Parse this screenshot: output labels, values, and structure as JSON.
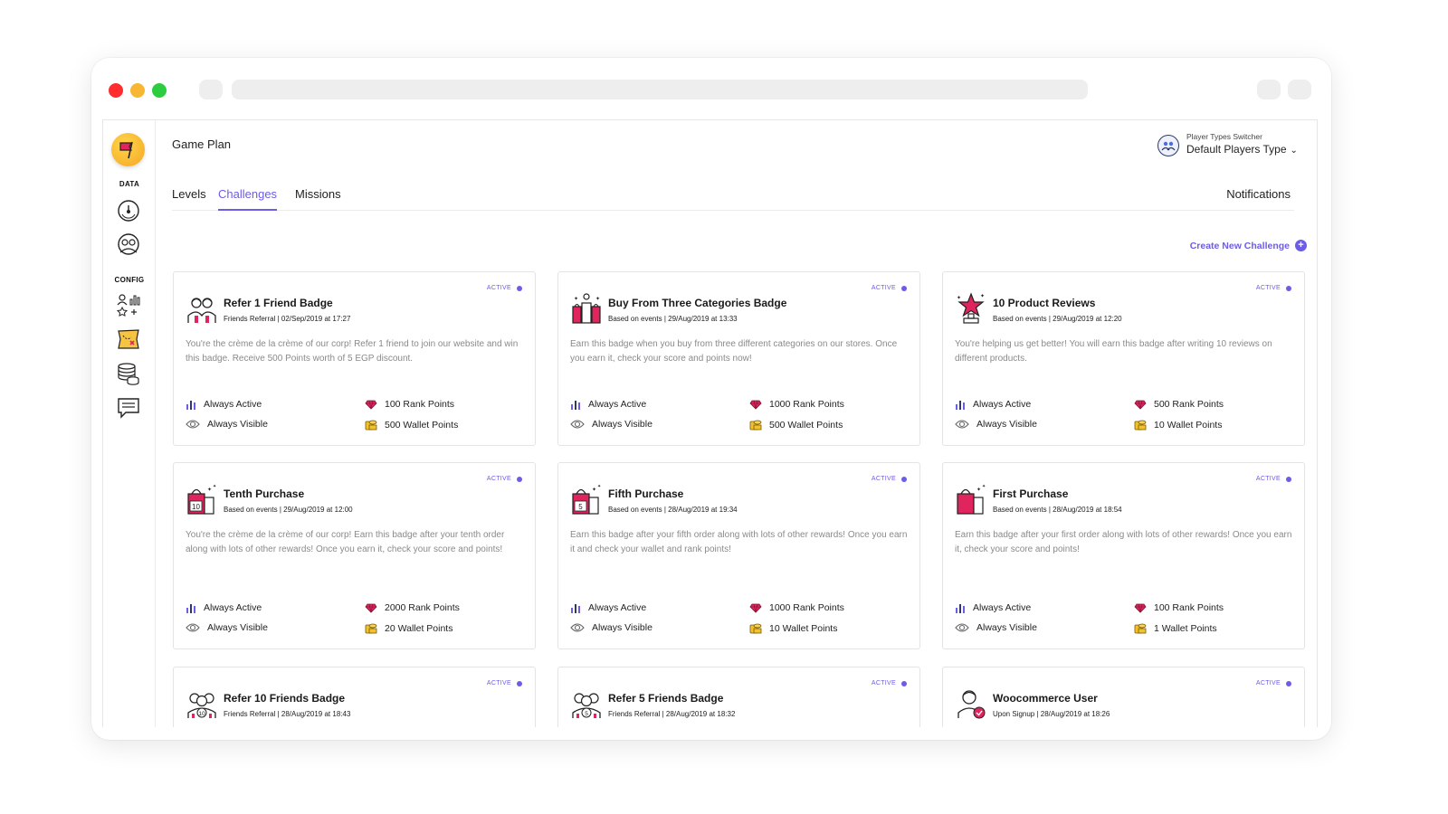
{
  "sidebar": {
    "section_data": "DATA",
    "section_config": "CONFIG",
    "items": [
      {
        "icon": "gauge-icon"
      },
      {
        "icon": "users-icon"
      },
      {
        "icon": "player-stats-icon"
      },
      {
        "icon": "treasure-map-icon"
      },
      {
        "icon": "coins-stack-icon"
      },
      {
        "icon": "chat-icon"
      }
    ]
  },
  "header": {
    "title": "Game Plan",
    "switcher_caption": "Player Types Switcher",
    "switcher_value": "Default Players Type"
  },
  "tabs": {
    "levels": "Levels",
    "challenges": "Challenges",
    "missions": "Missions",
    "notifications": "Notifications"
  },
  "create_button": "Create New Challenge",
  "labels": {
    "status": "ACTIVE",
    "always_active": "Always Active",
    "always_visible": "Always Visible"
  },
  "colors": {
    "accent": "#6c5ce7",
    "badge": "#e0245e"
  },
  "cards": [
    {
      "title": "Refer 1 Friend Badge",
      "meta": "Friends Referral | 02/Sep/2019 at 17:27",
      "description": "You're the crème de la crème of our corp! Refer 1 friend to join our website and win this badge. Receive 500 Points worth of 5 EGP discount.",
      "rank_points": "100 Rank Points",
      "wallet_points": "500 Wallet Points",
      "icon": "referral-badge-icon"
    },
    {
      "title": "Buy From Three Categories Badge",
      "meta": "Based on events | 29/Aug/2019 at 13:33",
      "description": "Earn this badge when you buy from three different categories on our stores. Once you earn it, check your score and points now!",
      "rank_points": "1000 Rank Points",
      "wallet_points": "500 Wallet Points",
      "icon": "shopping-bags-icon"
    },
    {
      "title": "10 Product Reviews",
      "meta": "Based on events | 29/Aug/2019 at 12:20",
      "description": "You're helping us get better! You will earn this badge after writing 10 reviews on different products.",
      "rank_points": "500 Rank Points",
      "wallet_points": "10 Wallet Points",
      "icon": "star-trophy-icon"
    },
    {
      "title": "Tenth Purchase",
      "meta": "Based on events | 29/Aug/2019 at 12:00",
      "description": "You're the crème de la crème of our corp! Earn this badge after your tenth order along with lots of other rewards! Once you earn it, check your score and points!",
      "rank_points": "2000 Rank Points",
      "wallet_points": "20 Wallet Points",
      "icon": "shopping-bag-icon",
      "bag_number": "10"
    },
    {
      "title": "Fifth Purchase",
      "meta": "Based on events | 28/Aug/2019 at 19:34",
      "description": "Earn this badge after your fifth order along with lots of other rewards! Once you earn it and check your wallet and rank points!",
      "rank_points": "1000 Rank Points",
      "wallet_points": "10 Wallet Points",
      "icon": "shopping-bag-icon",
      "bag_number": "5"
    },
    {
      "title": "First Purchase",
      "meta": "Based on events | 28/Aug/2019 at 18:54",
      "description": "Earn this badge after your first order along with lots of other rewards! Once you earn it, check your score and points!",
      "rank_points": "100 Rank Points",
      "wallet_points": "1 Wallet Points",
      "icon": "shopping-bag-icon"
    },
    {
      "title": "Refer 10 Friends Badge",
      "meta": "Friends Referral | 28/Aug/2019 at 18:43",
      "icon": "referral-group-icon",
      "bag_number": "10"
    },
    {
      "title": "Refer 5 Friends Badge",
      "meta": "Friends Referral | 28/Aug/2019 at 18:32",
      "icon": "referral-group-icon",
      "bag_number": "5"
    },
    {
      "title": "Woocommerce User",
      "meta": "Upon Signup | 28/Aug/2019 at 18:26",
      "icon": "signup-user-icon"
    }
  ]
}
